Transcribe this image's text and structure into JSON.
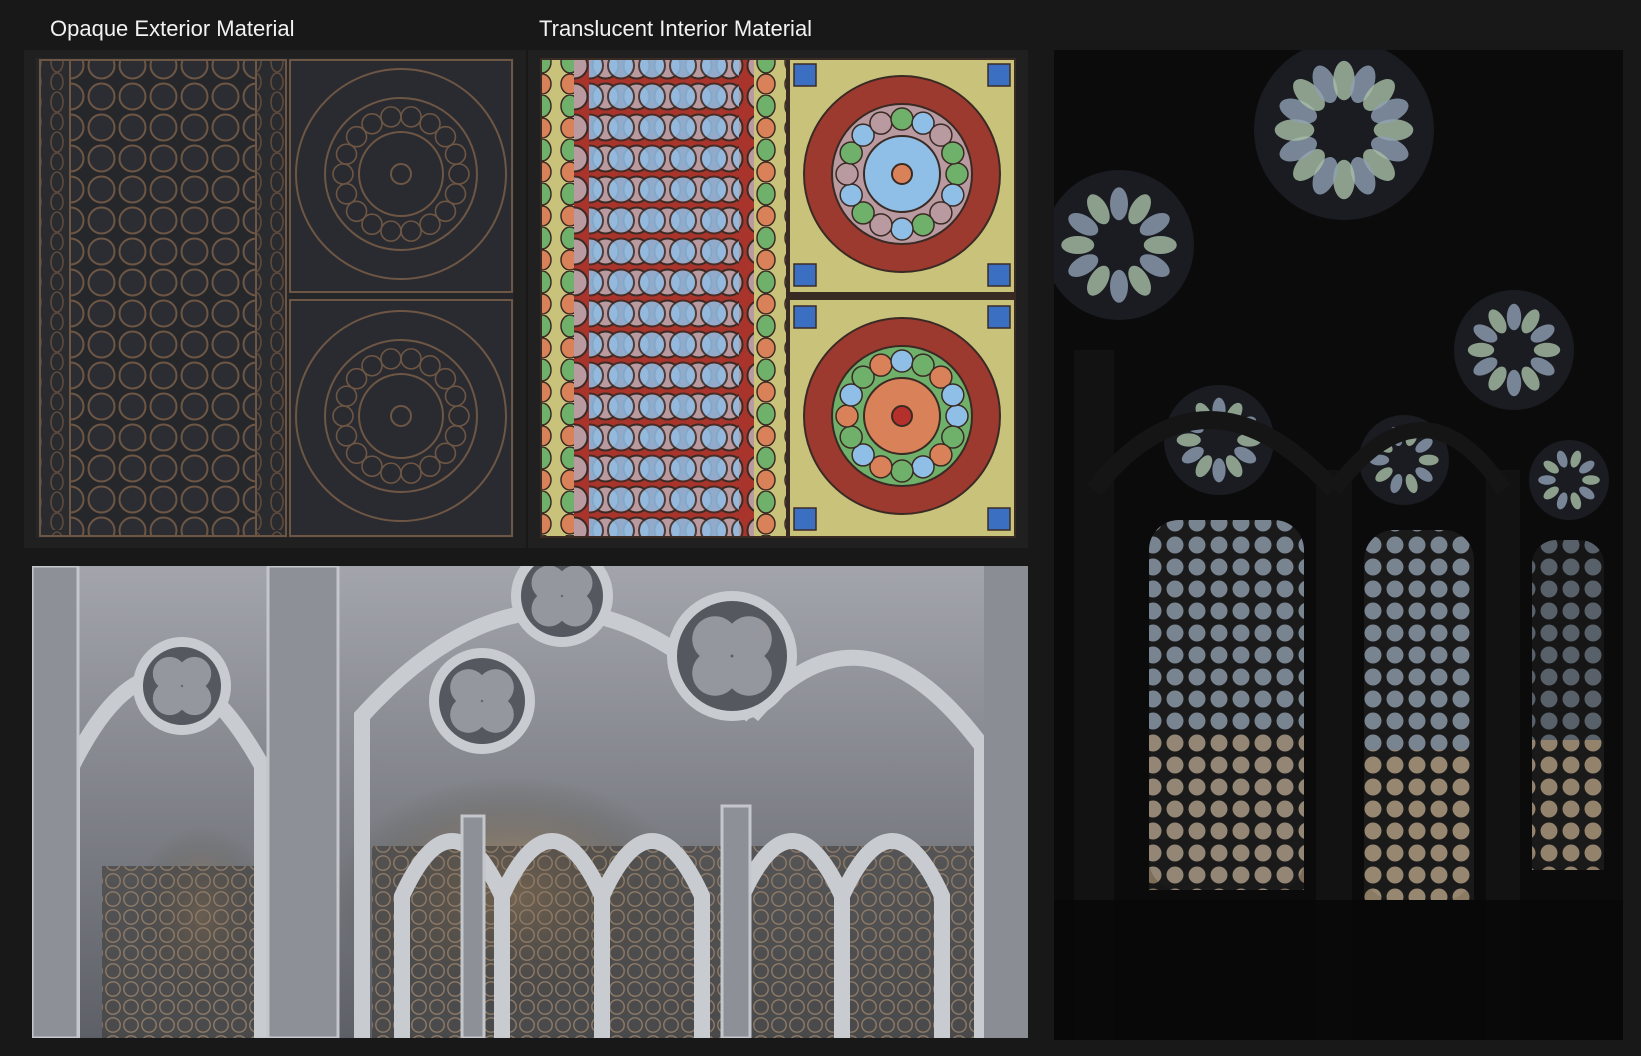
{
  "labels": {
    "opaque": "Opaque Exterior Material",
    "translucent": "Translucent Interior Material"
  },
  "colors": {
    "background": "#181818",
    "lead_copper": "#7a5a44",
    "glass_blue": "#8fbfe6",
    "glass_rose": "#b89aa0",
    "glass_green": "#6fb06a",
    "glass_orange": "#d9825a",
    "glass_red": "#b5302a",
    "glass_yellow": "#c9c27a",
    "stone_grey": "#8d9096"
  }
}
